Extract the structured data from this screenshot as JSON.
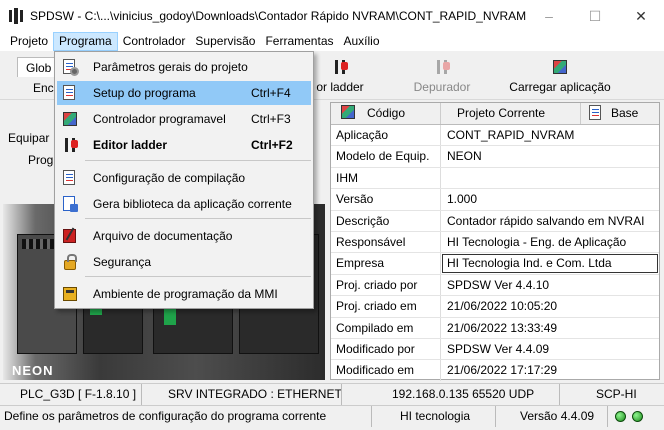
{
  "window": {
    "title": "SPDSW - C:\\...\\vinicius_godoy\\Downloads\\Contador Rápido NVRAM\\CONT_RAPID_NVRAM",
    "minimize_glyph": "–",
    "maximize_glyph": "☐",
    "close_glyph": "✕"
  },
  "menubar": {
    "items": [
      "Projeto",
      "Programa",
      "Controlador",
      "Supervisão",
      "Ferramentas",
      "Auxílio"
    ],
    "active": "Programa"
  },
  "toolbar": {
    "tab_label": "Glob",
    "encerrar_partial": "Enc",
    "ladder_partial": "or ladder",
    "depurador": "Depurador",
    "carregar": "Carregar aplicação"
  },
  "left_panel": {
    "equip_partial": "Equipar",
    "prog_partial": "Prog",
    "plc_label": "NEON"
  },
  "dropdown": {
    "items": [
      {
        "label": "Parâmetros gerais do projeto",
        "shortcut": "",
        "icon": "project-params-icon",
        "bold": false
      },
      {
        "label": "Setup do programa",
        "shortcut": "Ctrl+F4",
        "icon": "program-setup-icon",
        "bold": false
      },
      {
        "label": "Controlador programavel",
        "shortcut": "Ctrl+F3",
        "icon": "controller-icon",
        "bold": false
      },
      {
        "label": "Editor ladder",
        "shortcut": "Ctrl+F2",
        "icon": "ladder-icon",
        "bold": true
      },
      {
        "label": "Configuração de compilação",
        "shortcut": "",
        "icon": "compile-config-icon",
        "bold": false
      },
      {
        "label": "Gera biblioteca da aplicação corrente",
        "shortcut": "",
        "icon": "library-icon",
        "bold": false
      },
      {
        "label": "Arquivo de documentação",
        "shortcut": "",
        "icon": "documentation-icon",
        "bold": false
      },
      {
        "label": "Segurança",
        "shortcut": "",
        "icon": "lock-icon",
        "bold": false
      },
      {
        "label": "Ambiente de programação da MMI",
        "shortcut": "",
        "icon": "mmi-icon",
        "bold": false
      }
    ],
    "highlighted": "Setup do programa"
  },
  "grid": {
    "headers": {
      "codigo": "Código",
      "projeto": "Projeto Corrente",
      "base": "Base"
    },
    "rows": [
      {
        "key": "Aplicação",
        "value": "CONT_RAPID_NVRAM"
      },
      {
        "key": "Modelo de Equip.",
        "value": "NEON"
      },
      {
        "key": "IHM",
        "value": ""
      },
      {
        "key": "Versão",
        "value": "1.000"
      },
      {
        "key": "Descrição",
        "value": "Contador rápido salvando em NVRAI"
      },
      {
        "key": "Responsável",
        "value": "HI Tecnologia - Eng. de Aplicação"
      },
      {
        "key": "Empresa",
        "value": "HI Tecnologia Ind. e Com. Ltda"
      },
      {
        "key": "Proj. criado por",
        "value": "SPDSW Ver 4.4.10"
      },
      {
        "key": "Proj. criado em",
        "value": "21/06/2022 10:05:20"
      },
      {
        "key": "Compilado em",
        "value": "21/06/2022 13:33:49"
      },
      {
        "key": "Modificado por",
        "value": "SPDSW Ver 4.4.09"
      },
      {
        "key": "Modificado em",
        "value": "21/06/2022 17:17:29"
      }
    ]
  },
  "statusbar": {
    "plc": "PLC_G3D [ F-1.8.10 ]",
    "server": "SRV INTEGRADO : ETHERNET",
    "address": "192.168.0.135 65520 UDP",
    "scp": "SCP-HI",
    "hint": "Define os parâmetros de configuração do programa corrente",
    "company": "HI tecnologia",
    "version": "Versão 4.4.09"
  }
}
